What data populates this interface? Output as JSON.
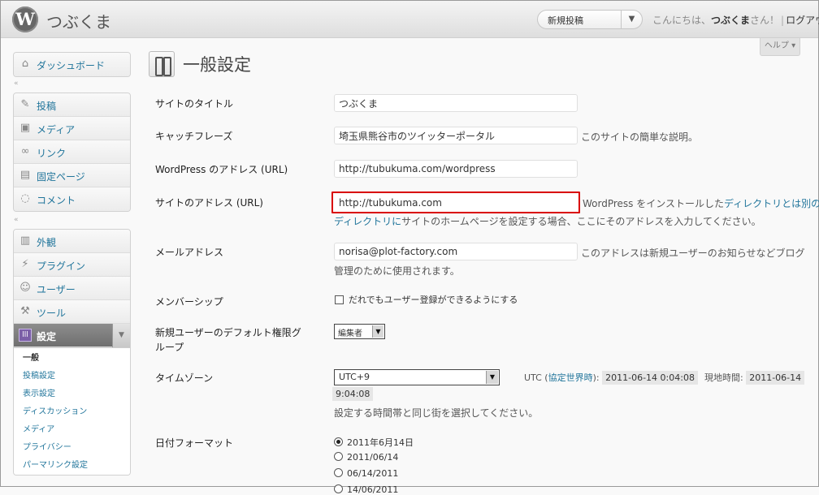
{
  "header": {
    "site_title": "つぶくま",
    "favorite_action": "新規投稿",
    "greeting_prefix": "こんにちは、",
    "user": "つぶくま",
    "greeting_suffix": "さん！",
    "separator": "|",
    "logout": "ログアウト",
    "help": "ヘルプ"
  },
  "sidebar": {
    "dashboard": "ダッシュボード",
    "collapse_glyph": "«",
    "content": [
      "投稿",
      "メディア",
      "リンク",
      "固定ページ",
      "コメント"
    ],
    "admin": [
      "外観",
      "プラグイン",
      "ユーザー",
      "ツール"
    ],
    "settings": "設定",
    "settings_icon_text": "lll",
    "submenu": [
      "一般",
      "投稿設定",
      "表示設定",
      "ディスカッション",
      "メディア",
      "プライバシー",
      "パーマリンク設定"
    ]
  },
  "main": {
    "title": "一般設定",
    "site_title_label": "サイトのタイトル",
    "site_title_value": "つぶくま",
    "tagline_label": "キャッチフレーズ",
    "tagline_value": "埼玉県熊谷市のツイッターポータル",
    "tagline_desc": "このサイトの簡単な説明。",
    "wp_url_label": "WordPress のアドレス (URL)",
    "wp_url_value": "http://tubukuma.com/wordpress",
    "site_url_label": "サイトのアドレス (URL)",
    "site_url_value": "http://tubukuma.com",
    "site_url_desc_1": "WordPress をインストールした",
    "site_url_link_1": "ディレクトリとは別の",
    "site_url_link_2": "ディレクトリに",
    "site_url_desc_2": "サイトのホームページを設定する場合、ここにそのアドレスを入力してください。",
    "email_label": "メールアドレス",
    "email_value": "norisa@plot-factory.com",
    "email_desc_1": "このアドレスは新規ユーザーのお知らせなどブログ",
    "email_desc_2": "管理のために使用されます。",
    "membership_label": "メンバーシップ",
    "membership_checkbox": "だれでもユーザー登録ができるようにする",
    "default_role_label_1": "新規ユーザーのデフォルト権限グ",
    "default_role_label_2": "ループ",
    "default_role_value": "編集者",
    "timezone_label": "タイムゾーン",
    "timezone_value": "UTC+9",
    "utc_prefix": "UTC (",
    "utc_link": "協定世界時",
    "utc_suffix": "):",
    "utc_time": "2011-06-14 0:04:08",
    "local_label": "現地時間:",
    "local_time_1": "2011-06-14",
    "local_time_2": "9:04:08",
    "timezone_desc": "設定する時間帯と同じ街を選択してください。",
    "date_format_label": "日付フォーマット",
    "date_formats": [
      "2011年6月14日",
      "2011/06/14",
      "06/14/2011",
      "14/06/2011"
    ],
    "selected_date_format": 0
  }
}
